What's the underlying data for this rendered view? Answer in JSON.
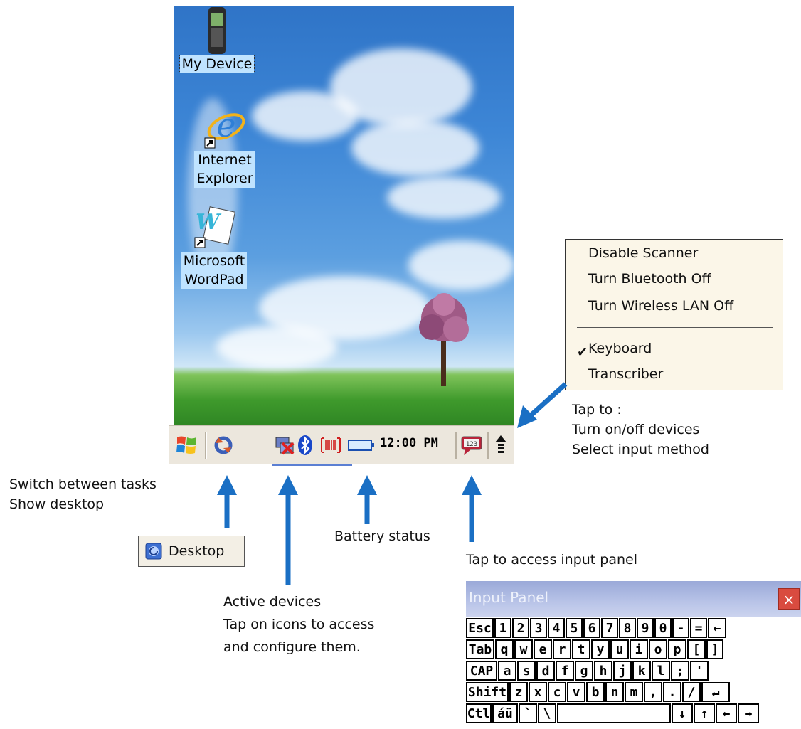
{
  "desktop": {
    "icons": [
      {
        "label": "My Device"
      },
      {
        "label_lines": [
          "Internet",
          "Explorer"
        ]
      },
      {
        "label_lines": [
          "Microsoft",
          "WordPad"
        ]
      }
    ]
  },
  "taskbar": {
    "clock": "12:00 PM",
    "icons": [
      "windows-start-icon",
      "task-switch-icon",
      "network-disconnected-icon",
      "bluetooth-icon",
      "barcode-scanner-icon",
      "battery-icon",
      "input-panel-icon",
      "up-arrow-icon"
    ]
  },
  "menu": {
    "items": [
      {
        "label": "Disable Scanner"
      },
      {
        "label": "Turn Bluetooth Off"
      },
      {
        "label": "Turn Wireless LAN Off"
      },
      {
        "label": "Keyboard",
        "checked": true
      },
      {
        "label": "Transcriber"
      }
    ]
  },
  "annotations": {
    "tap_to": [
      "Tap to :",
      "Turn on/off devices",
      "Select input method"
    ],
    "switch": [
      "Switch between tasks",
      "Show desktop"
    ],
    "battery": "Battery status",
    "input_panel": "Tap to access input panel",
    "active": [
      "Active devices",
      "Tap on icons to access",
      "and configure them."
    ]
  },
  "desktop_button": {
    "label": "Desktop"
  },
  "input_panel": {
    "title": "Input Panel",
    "close": "×",
    "rows": [
      [
        "Esc",
        "1",
        "2",
        "3",
        "4",
        "5",
        "6",
        "7",
        "8",
        "9",
        "0",
        "-",
        "=",
        "←"
      ],
      [
        "Tab",
        "q",
        "w",
        "e",
        "r",
        "t",
        "y",
        "u",
        "i",
        "o",
        "p",
        "[",
        "]"
      ],
      [
        "CAP",
        "a",
        "s",
        "d",
        "f",
        "g",
        "h",
        "j",
        "k",
        "l",
        ";",
        "'"
      ],
      [
        "Shift",
        "z",
        "x",
        "c",
        "v",
        "b",
        "n",
        "m",
        ",",
        ".",
        "/",
        "↵"
      ],
      [
        "Ctl",
        "áü",
        "`",
        "\\",
        " ",
        "↓",
        "↑",
        "←",
        "→"
      ]
    ]
  },
  "colors": {
    "arrow": "#1a6fc4",
    "taskbar": "#ece7dd",
    "menu_bg": "#fbf6e8"
  }
}
